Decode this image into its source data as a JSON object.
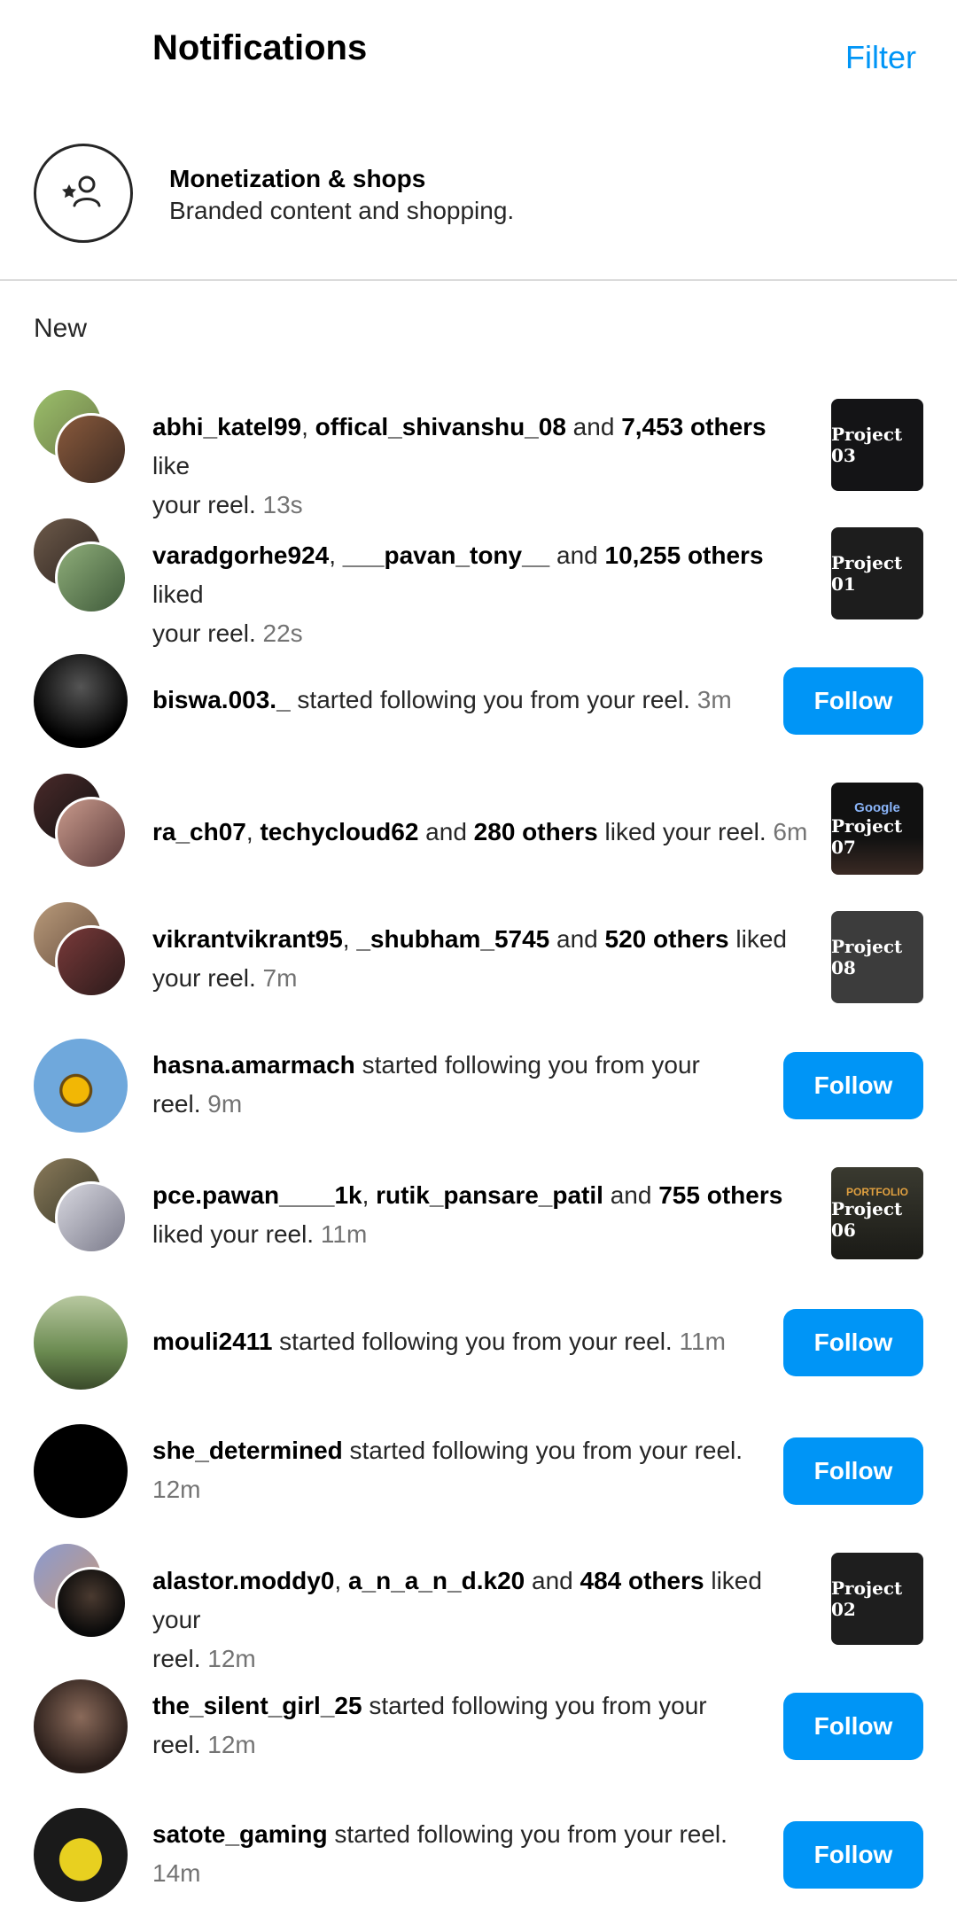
{
  "header": {
    "title": "Notifications",
    "filter": "Filter"
  },
  "monetization": {
    "title": "Monetization & shops",
    "subtitle": "Branded content and shopping."
  },
  "section": "New",
  "colors": {
    "accent": "#0095f6",
    "muted": "#737373"
  },
  "rows": [
    {
      "u1": "abhi_katel99",
      "sep": ", ",
      "u2": "offical_shivanshu_08",
      "mid": " and ",
      "others": "7,453 others",
      "end": " like",
      "line2": "your reel. ",
      "time": "13s",
      "thumb": "Project 03"
    },
    {
      "u1": "varadgorhe924",
      "sep": ", ",
      "u2": "___pavan_tony__",
      "mid": " and ",
      "others": "10,255 others",
      "end": " liked",
      "line2": "your reel. ",
      "time": "22s",
      "thumb": "Project 01"
    },
    {
      "u1": "biswa.003._",
      "text": " started following you from your reel. ",
      "time": "3m",
      "button": "Follow"
    },
    {
      "u1": "ra_ch07",
      "sep": ", ",
      "u2": "techycloud62",
      "mid": " and ",
      "others": "280 others",
      "end": " liked your reel. ",
      "time": "6m",
      "thumb": "Project 07",
      "thumb_top": "Google"
    },
    {
      "u1": "vikrantvikrant95",
      "sep": ", ",
      "u2": "_shubham_5745",
      "mid": " and ",
      "others": "520 others",
      "end": " liked",
      "line2": "your reel. ",
      "time": "7m",
      "thumb": "Project 08"
    },
    {
      "u1": "hasna.amarmach",
      "text": " started following you from your",
      "line2": "reel. ",
      "time": "9m",
      "button": "Follow"
    },
    {
      "u1": "pce.pawan____1k",
      "sep": ", ",
      "u2": "rutik_pansare_patil",
      "mid": " and ",
      "others": "755 others",
      "line2": "liked your reel. ",
      "time": "11m",
      "thumb": "Project 06",
      "thumb_top": "PORTFOLIO"
    },
    {
      "u1": "mouli2411",
      "text": " started following you from your reel. ",
      "time": "11m",
      "button": "Follow"
    },
    {
      "u1": "she_determined",
      "text": " started following you from your reel.",
      "line2": "",
      "time": "12m",
      "button": "Follow"
    },
    {
      "u1": "alastor.moddy0",
      "sep": ", ",
      "u2": "a_n_a_n_d.k20",
      "mid": " and ",
      "others": "484 others",
      "end": " liked your",
      "line2": "reel. ",
      "time": "12m",
      "thumb": "Project 02"
    },
    {
      "u1": "the_silent_girl_25",
      "text": " started following you from your",
      "line2": "reel. ",
      "time": "12m",
      "button": "Follow"
    },
    {
      "u1": "satote_gaming",
      "text": " started following you from your reel.",
      "line2": "",
      "time": "14m",
      "button": "Follow"
    }
  ]
}
